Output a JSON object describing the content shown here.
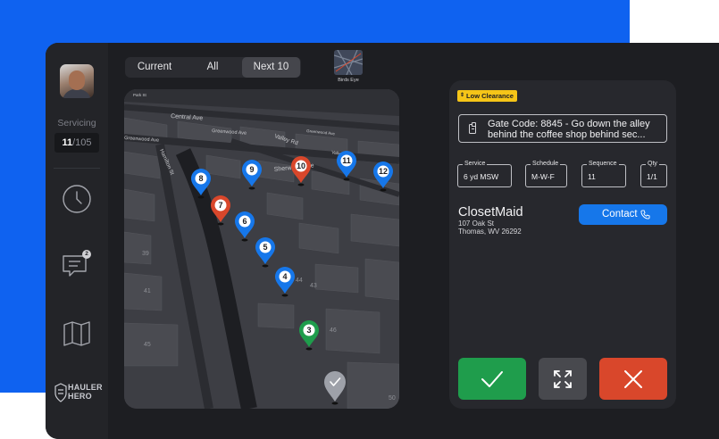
{
  "sidebar": {
    "servicing_label": "Servicing",
    "servicing_current": "11",
    "servicing_total": "/105",
    "messages_badge": "2",
    "brand_line1": "HAULER",
    "brand_line2": "HERO",
    "icons": [
      "avatar",
      "clock-icon",
      "messages-icon",
      "map-icon",
      "hauler-hero-logo"
    ]
  },
  "tabs": [
    {
      "label": "Current",
      "active": false
    },
    {
      "label": "All",
      "active": false
    },
    {
      "label": "Next 10",
      "active": true
    }
  ],
  "birds_eye_label": "Birds Eye",
  "map": {
    "streets": [
      "Central Ave",
      "Greenwood Ave",
      "Valley Rd",
      "Sherwood Ave",
      "Hamilton St",
      "Greenwood Ave",
      "Park St",
      "Valley Rd",
      "Greenwood Ave"
    ],
    "building_numbers": [
      "39",
      "41",
      "43",
      "44",
      "45",
      "46",
      "50"
    ],
    "pins": [
      {
        "label": "8",
        "color": "#1677ea"
      },
      {
        "label": "9",
        "color": "#1677ea"
      },
      {
        "label": "10",
        "color": "#d9472b"
      },
      {
        "label": "11",
        "color": "#1677ea"
      },
      {
        "label": "12",
        "color": "#1677ea"
      },
      {
        "label": "7",
        "color": "#d9472b"
      },
      {
        "label": "6",
        "color": "#1677ea"
      },
      {
        "label": "5",
        "color": "#1677ea"
      },
      {
        "label": "4",
        "color": "#1677ea"
      },
      {
        "label": "3",
        "color": "#1f9d4c"
      }
    ],
    "completed_pin_icon": "check-icon"
  },
  "panel": {
    "badge": "Low Clearance",
    "gate_line1": "Gate Code: 8845 - Go down the alley",
    "gate_line2": "behind the coffee shop behind sec...",
    "fields": [
      {
        "label": "Service",
        "value": "6 yd MSW"
      },
      {
        "label": "Schedule",
        "value": "M-W-F"
      },
      {
        "label": "Sequence",
        "value": "11"
      },
      {
        "label": "Qty",
        "value": "1/1"
      }
    ],
    "customer_name": "ClosetMaid",
    "address_line1": "107 Oak St",
    "address_line2": "Thomas, WV 26292",
    "contact_label": "Contact",
    "colors": {
      "confirm": "#1f9d4c",
      "expand": "#48494e",
      "cancel": "#d9472b",
      "contact": "#1677ea",
      "badge": "#f5c518"
    }
  }
}
